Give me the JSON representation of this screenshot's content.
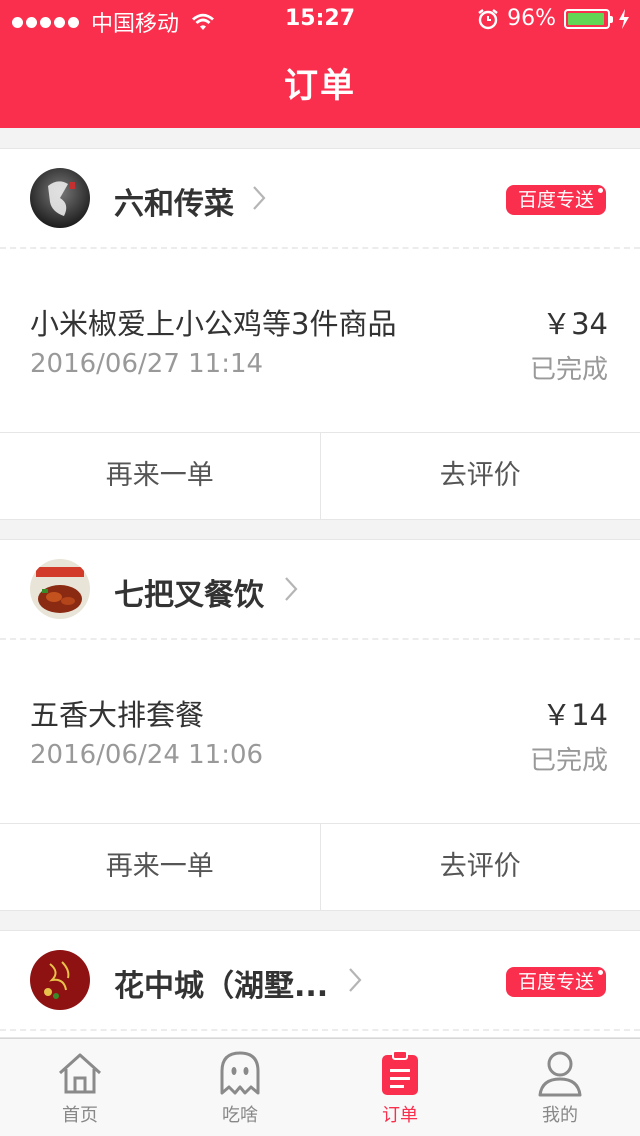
{
  "status_bar": {
    "carrier": "中国移动",
    "time": "15:27",
    "battery_percent": "96%",
    "battery_level": 0.96
  },
  "header": {
    "title": "订单"
  },
  "orders": [
    {
      "shop_name": "六和传菜",
      "badge": "百度专送",
      "item_title": "小米椒爱上小公鸡等3件商品",
      "time": "2016/06/27 11:14",
      "price": "￥34",
      "status": "已完成",
      "reorder_label": "再来一单",
      "review_label": "去评价"
    },
    {
      "shop_name": "七把叉餐饮",
      "badge": "",
      "item_title": "五香大排套餐",
      "time": "2016/06/24 11:06",
      "price": "￥14",
      "status": "已完成",
      "reorder_label": "再来一单",
      "review_label": "去评价"
    },
    {
      "shop_name": "花中城（湖墅...",
      "badge": "百度专送"
    }
  ],
  "tabbar": {
    "items": [
      {
        "label": "首页",
        "icon": "home-icon",
        "active": false
      },
      {
        "label": "吃啥",
        "icon": "ghost-icon",
        "active": false
      },
      {
        "label": "订单",
        "icon": "clipboard-icon",
        "active": true
      },
      {
        "label": "我的",
        "icon": "user-icon",
        "active": false
      }
    ]
  },
  "colors": {
    "accent": "#fa2e4d",
    "battery": "#62d755"
  }
}
